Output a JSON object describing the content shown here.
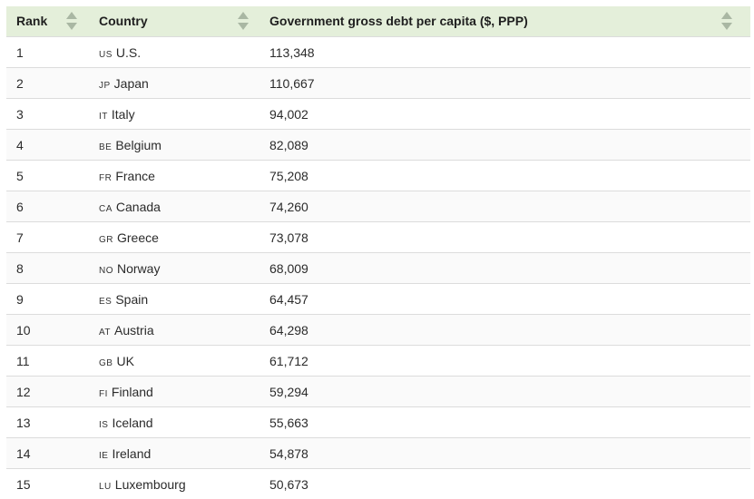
{
  "table": {
    "headers": {
      "rank": "Rank",
      "country": "Country",
      "debt": "Government gross debt per capita ($, PPP)"
    },
    "rows": [
      {
        "rank": "1",
        "code": "US",
        "country": "U.S.",
        "debt": "113,348"
      },
      {
        "rank": "2",
        "code": "JP",
        "country": "Japan",
        "debt": "110,667"
      },
      {
        "rank": "3",
        "code": "IT",
        "country": "Italy",
        "debt": "94,002"
      },
      {
        "rank": "4",
        "code": "BE",
        "country": "Belgium",
        "debt": "82,089"
      },
      {
        "rank": "5",
        "code": "FR",
        "country": "France",
        "debt": "75,208"
      },
      {
        "rank": "6",
        "code": "CA",
        "country": "Canada",
        "debt": "74,260"
      },
      {
        "rank": "7",
        "code": "GR",
        "country": "Greece",
        "debt": "73,078"
      },
      {
        "rank": "8",
        "code": "NO",
        "country": "Norway",
        "debt": "68,009"
      },
      {
        "rank": "9",
        "code": "ES",
        "country": "Spain",
        "debt": "64,457"
      },
      {
        "rank": "10",
        "code": "AT",
        "country": "Austria",
        "debt": "64,298"
      },
      {
        "rank": "11",
        "code": "GB",
        "country": "UK",
        "debt": "61,712"
      },
      {
        "rank": "12",
        "code": "FI",
        "country": "Finland",
        "debt": "59,294"
      },
      {
        "rank": "13",
        "code": "IS",
        "country": "Iceland",
        "debt": "55,663"
      },
      {
        "rank": "14",
        "code": "IE",
        "country": "Ireland",
        "debt": "54,878"
      },
      {
        "rank": "15",
        "code": "LU",
        "country": "Luxembourg",
        "debt": "50,673"
      }
    ]
  },
  "colors": {
    "header_bg": "#e4efda",
    "sort_arrow": "#a9b7a3",
    "row_border": "#dcdcdc"
  },
  "icons": {
    "sort": "sort-arrows-icon"
  }
}
